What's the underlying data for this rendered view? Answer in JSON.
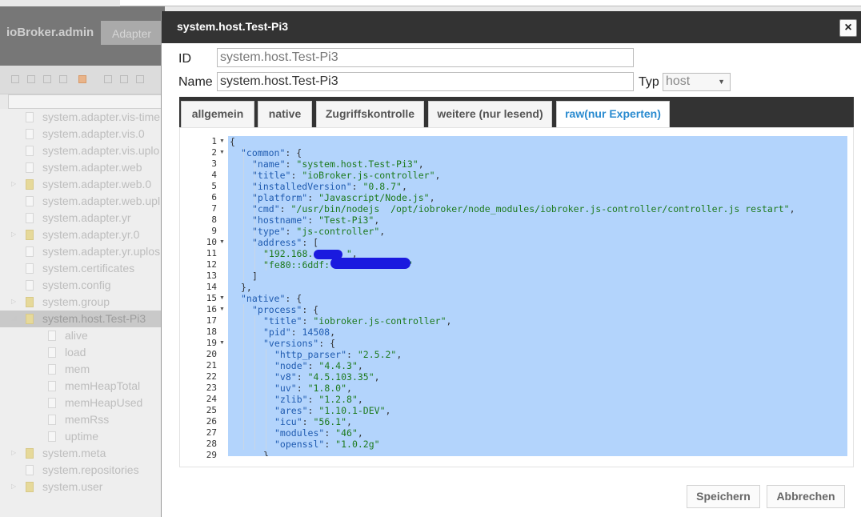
{
  "background": {
    "brand": "ioBroker.admin",
    "tab": "Adapter",
    "tree": [
      {
        "label": "system.adapter.vis-time",
        "folder": false,
        "expander": false,
        "indent": 0
      },
      {
        "label": "system.adapter.vis.0",
        "folder": false,
        "expander": false,
        "indent": 0
      },
      {
        "label": "system.adapter.vis.uplo",
        "folder": false,
        "expander": false,
        "indent": 0
      },
      {
        "label": "system.adapter.web",
        "folder": false,
        "expander": false,
        "indent": 0
      },
      {
        "label": "system.adapter.web.0",
        "folder": true,
        "expander": true,
        "indent": 0
      },
      {
        "label": "system.adapter.web.upl",
        "folder": false,
        "expander": false,
        "indent": 0
      },
      {
        "label": "system.adapter.yr",
        "folder": false,
        "expander": false,
        "indent": 0
      },
      {
        "label": "system.adapter.yr.0",
        "folder": true,
        "expander": true,
        "indent": 0
      },
      {
        "label": "system.adapter.yr.uplos",
        "folder": false,
        "expander": false,
        "indent": 0
      },
      {
        "label": "system.certificates",
        "folder": false,
        "expander": false,
        "indent": 0
      },
      {
        "label": "system.config",
        "folder": false,
        "expander": false,
        "indent": 0
      },
      {
        "label": "system.group",
        "folder": true,
        "expander": true,
        "indent": 0
      },
      {
        "label": "system.host.Test-Pi3",
        "folder": true,
        "expander": true,
        "indent": 0,
        "selected": true
      },
      {
        "label": "alive",
        "folder": false,
        "expander": false,
        "indent": 1
      },
      {
        "label": "load",
        "folder": false,
        "expander": false,
        "indent": 1
      },
      {
        "label": "mem",
        "folder": false,
        "expander": false,
        "indent": 1
      },
      {
        "label": "memHeapTotal",
        "folder": false,
        "expander": false,
        "indent": 1
      },
      {
        "label": "memHeapUsed",
        "folder": false,
        "expander": false,
        "indent": 1
      },
      {
        "label": "memRss",
        "folder": false,
        "expander": false,
        "indent": 1
      },
      {
        "label": "uptime",
        "folder": false,
        "expander": false,
        "indent": 1
      },
      {
        "label": "system.meta",
        "folder": true,
        "expander": true,
        "indent": 0
      },
      {
        "label": "system.repositories",
        "folder": false,
        "expander": false,
        "indent": 0
      },
      {
        "label": "system.user",
        "folder": true,
        "expander": true,
        "indent": 0
      }
    ]
  },
  "dialog": {
    "title": "system.host.Test-Pi3",
    "close_label": "×",
    "id_label": "ID",
    "id_value": "system.host.Test-Pi3",
    "name_label": "Name",
    "name_value": "system.host.Test-Pi3",
    "typ_label": "Typ",
    "typ_value": "host",
    "tabs": [
      "allgemein",
      "native",
      "Zugriffskontrolle",
      "weitere (nur lesend)",
      "raw(nur Experten)"
    ],
    "active_tab": 4,
    "save_label": "Speichern",
    "cancel_label": "Abbrechen"
  },
  "editor": {
    "lines": [
      {
        "n": "1",
        "fold": true,
        "indent": 0,
        "t": [
          [
            "p",
            "{"
          ]
        ]
      },
      {
        "n": "2",
        "fold": true,
        "indent": 1,
        "t": [
          [
            "k",
            "\"common\""
          ],
          [
            "p",
            ": {"
          ]
        ]
      },
      {
        "n": "3",
        "fold": false,
        "indent": 2,
        "t": [
          [
            "k",
            "\"name\""
          ],
          [
            "p",
            ": "
          ],
          [
            "s",
            "\"system.host.Test-Pi3\""
          ],
          [
            "p",
            ","
          ]
        ]
      },
      {
        "n": "4",
        "fold": false,
        "indent": 2,
        "t": [
          [
            "k",
            "\"title\""
          ],
          [
            "p",
            ": "
          ],
          [
            "s",
            "\"ioBroker.js-controller\""
          ],
          [
            "p",
            ","
          ]
        ]
      },
      {
        "n": "5",
        "fold": false,
        "indent": 2,
        "t": [
          [
            "k",
            "\"installedVersion\""
          ],
          [
            "p",
            ": "
          ],
          [
            "s",
            "\"0.8.7\""
          ],
          [
            "p",
            ","
          ]
        ]
      },
      {
        "n": "6",
        "fold": false,
        "indent": 2,
        "t": [
          [
            "k",
            "\"platform\""
          ],
          [
            "p",
            ": "
          ],
          [
            "s",
            "\"Javascript/Node.js\""
          ],
          [
            "p",
            ","
          ]
        ]
      },
      {
        "n": "7",
        "fold": false,
        "indent": 2,
        "t": [
          [
            "k",
            "\"cmd\""
          ],
          [
            "p",
            ": "
          ],
          [
            "s",
            "\"/usr/bin/nodejs  /opt/iobroker/node_modules/iobroker.js-controller/controller.js restart\""
          ],
          [
            "p",
            ","
          ]
        ]
      },
      {
        "n": "8",
        "fold": false,
        "indent": 2,
        "t": [
          [
            "k",
            "\"hostname\""
          ],
          [
            "p",
            ": "
          ],
          [
            "s",
            "\"Test-Pi3\""
          ],
          [
            "p",
            ","
          ]
        ]
      },
      {
        "n": "9",
        "fold": false,
        "indent": 2,
        "t": [
          [
            "k",
            "\"type\""
          ],
          [
            "p",
            ": "
          ],
          [
            "s",
            "\"js-controller\""
          ],
          [
            "p",
            ","
          ]
        ]
      },
      {
        "n": "10",
        "fold": true,
        "indent": 2,
        "t": [
          [
            "k",
            "\"address\""
          ],
          [
            "p",
            ": ["
          ]
        ]
      },
      {
        "n": "11",
        "fold": false,
        "indent": 3,
        "t": [
          [
            "s",
            "\"192.168.      \""
          ],
          [
            "p",
            ","
          ]
        ]
      },
      {
        "n": "12",
        "fold": false,
        "indent": 3,
        "t": [
          [
            "s",
            "\"fe80::6ddf:             3\""
          ]
        ]
      },
      {
        "n": "13",
        "fold": false,
        "indent": 2,
        "t": [
          [
            "p",
            "]"
          ]
        ]
      },
      {
        "n": "14",
        "fold": false,
        "indent": 1,
        "t": [
          [
            "p",
            "},"
          ]
        ]
      },
      {
        "n": "15",
        "fold": true,
        "indent": 1,
        "t": [
          [
            "k",
            "\"native\""
          ],
          [
            "p",
            ": {"
          ]
        ]
      },
      {
        "n": "16",
        "fold": true,
        "indent": 2,
        "t": [
          [
            "k",
            "\"process\""
          ],
          [
            "p",
            ": {"
          ]
        ]
      },
      {
        "n": "17",
        "fold": false,
        "indent": 3,
        "t": [
          [
            "k",
            "\"title\""
          ],
          [
            "p",
            ": "
          ],
          [
            "s",
            "\"iobroker.js-controller\""
          ],
          [
            "p",
            ","
          ]
        ]
      },
      {
        "n": "18",
        "fold": false,
        "indent": 3,
        "t": [
          [
            "k",
            "\"pid\""
          ],
          [
            "p",
            ": "
          ],
          [
            "n",
            "14508"
          ],
          [
            "p",
            ","
          ]
        ]
      },
      {
        "n": "19",
        "fold": true,
        "indent": 3,
        "t": [
          [
            "k",
            "\"versions\""
          ],
          [
            "p",
            ": {"
          ]
        ]
      },
      {
        "n": "20",
        "fold": false,
        "indent": 4,
        "t": [
          [
            "k",
            "\"http_parser\""
          ],
          [
            "p",
            ": "
          ],
          [
            "s",
            "\"2.5.2\""
          ],
          [
            "p",
            ","
          ]
        ]
      },
      {
        "n": "21",
        "fold": false,
        "indent": 4,
        "t": [
          [
            "k",
            "\"node\""
          ],
          [
            "p",
            ": "
          ],
          [
            "s",
            "\"4.4.3\""
          ],
          [
            "p",
            ","
          ]
        ]
      },
      {
        "n": "22",
        "fold": false,
        "indent": 4,
        "t": [
          [
            "k",
            "\"v8\""
          ],
          [
            "p",
            ": "
          ],
          [
            "s",
            "\"4.5.103.35\""
          ],
          [
            "p",
            ","
          ]
        ]
      },
      {
        "n": "23",
        "fold": false,
        "indent": 4,
        "t": [
          [
            "k",
            "\"uv\""
          ],
          [
            "p",
            ": "
          ],
          [
            "s",
            "\"1.8.0\""
          ],
          [
            "p",
            ","
          ]
        ]
      },
      {
        "n": "24",
        "fold": false,
        "indent": 4,
        "t": [
          [
            "k",
            "\"zlib\""
          ],
          [
            "p",
            ": "
          ],
          [
            "s",
            "\"1.2.8\""
          ],
          [
            "p",
            ","
          ]
        ]
      },
      {
        "n": "25",
        "fold": false,
        "indent": 4,
        "t": [
          [
            "k",
            "\"ares\""
          ],
          [
            "p",
            ": "
          ],
          [
            "s",
            "\"1.10.1-DEV\""
          ],
          [
            "p",
            ","
          ]
        ]
      },
      {
        "n": "26",
        "fold": false,
        "indent": 4,
        "t": [
          [
            "k",
            "\"icu\""
          ],
          [
            "p",
            ": "
          ],
          [
            "s",
            "\"56.1\""
          ],
          [
            "p",
            ","
          ]
        ]
      },
      {
        "n": "27",
        "fold": false,
        "indent": 4,
        "t": [
          [
            "k",
            "\"modules\""
          ],
          [
            "p",
            ": "
          ],
          [
            "s",
            "\"46\""
          ],
          [
            "p",
            ","
          ]
        ]
      },
      {
        "n": "28",
        "fold": false,
        "indent": 4,
        "t": [
          [
            "k",
            "\"openssl\""
          ],
          [
            "p",
            ": "
          ],
          [
            "s",
            "\"1.0.2g\""
          ]
        ]
      },
      {
        "n": "29",
        "fold": false,
        "indent": 3,
        "t": [
          [
            "p",
            "},"
          ]
        ]
      }
    ]
  }
}
